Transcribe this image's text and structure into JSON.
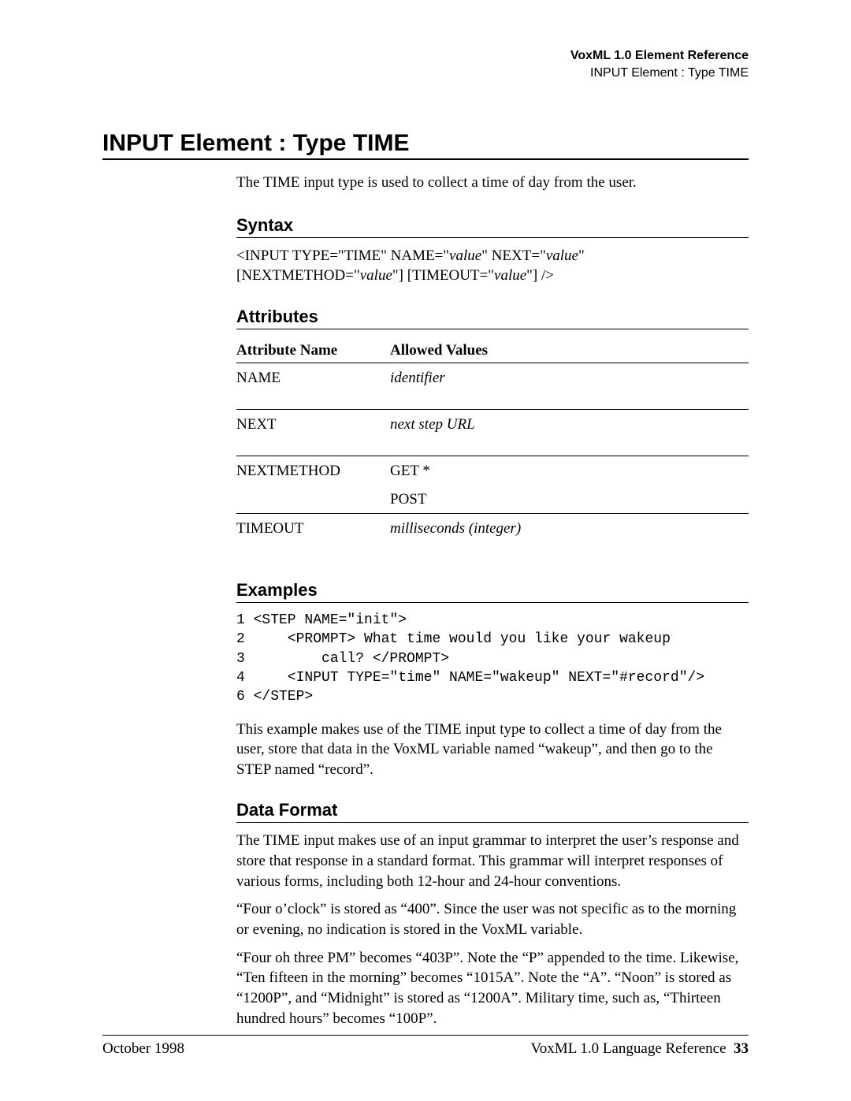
{
  "header": {
    "line1": "VoxML 1.0 Element Reference",
    "line2": "INPUT Element : Type TIME"
  },
  "title": "INPUT Element : Type TIME",
  "intro": "The TIME input type is used to collect a time of day from the user.",
  "sections": {
    "syntax_head": "Syntax",
    "attributes_head": "Attributes",
    "examples_head": "Examples",
    "dataformat_head": "Data Format"
  },
  "syntax": {
    "p1a": "<INPUT TYPE=\"TIME\" NAME=\"",
    "p1b": "value",
    "p1c": "\" NEXT=\"",
    "p1d": "value",
    "p1e": "\"",
    "p2a": "[NEXTMETHOD=\"",
    "p2b": "value",
    "p2c": "\"] [TIMEOUT=\"",
    "p2d": "value",
    "p2e": "\"] />"
  },
  "attr_table": {
    "col1": "Attribute Name",
    "col2": "Allowed Values",
    "rows": [
      {
        "name": "NAME",
        "value": "identifier",
        "ital": true
      },
      {
        "name": "NEXT",
        "value": "next step URL",
        "ital": true
      },
      {
        "name": "NEXTMETHOD",
        "value": "GET *",
        "ital": false,
        "value2": "POST"
      },
      {
        "name": "TIMEOUT",
        "value": "milliseconds (integer)",
        "ital": true
      }
    ]
  },
  "example_code": "1 <STEP NAME=\"init\">\n2     <PROMPT> What time would you like your wakeup\n3         call? </PROMPT>\n4     <INPUT TYPE=\"time\" NAME=\"wakeup\" NEXT=\"#record\"/>\n6 </STEP>",
  "example_desc": "This example makes use of the TIME input type to collect a time of day from the user, store that data in the VoxML variable named “wakeup”, and then go to the STEP named “record”.",
  "dataformat": {
    "p1": "The TIME input makes use of an input grammar to interpret the user’s response and store that response in a standard format.  This grammar will interpret responses of various forms, including both 12-hour and 24-hour conventions.",
    "p2": "“Four o’clock” is stored as “400”.  Since the user was not specific as to the morning or evening, no indication is stored in the VoxML variable.",
    "p3": "“Four oh three PM” becomes “403P”.  Note the “P” appended to the time.  Likewise, “Ten fifteen in the morning” becomes “1015A”.  Note the “A”.  “Noon” is stored as “1200P”, and “Midnight” is stored as “1200A”.  Military time, such as, “Thirteen hundred hours” becomes “100P”."
  },
  "footer": {
    "left": "October 1998",
    "right_text": "VoxML 1.0 Language Reference",
    "right_page": "33"
  }
}
